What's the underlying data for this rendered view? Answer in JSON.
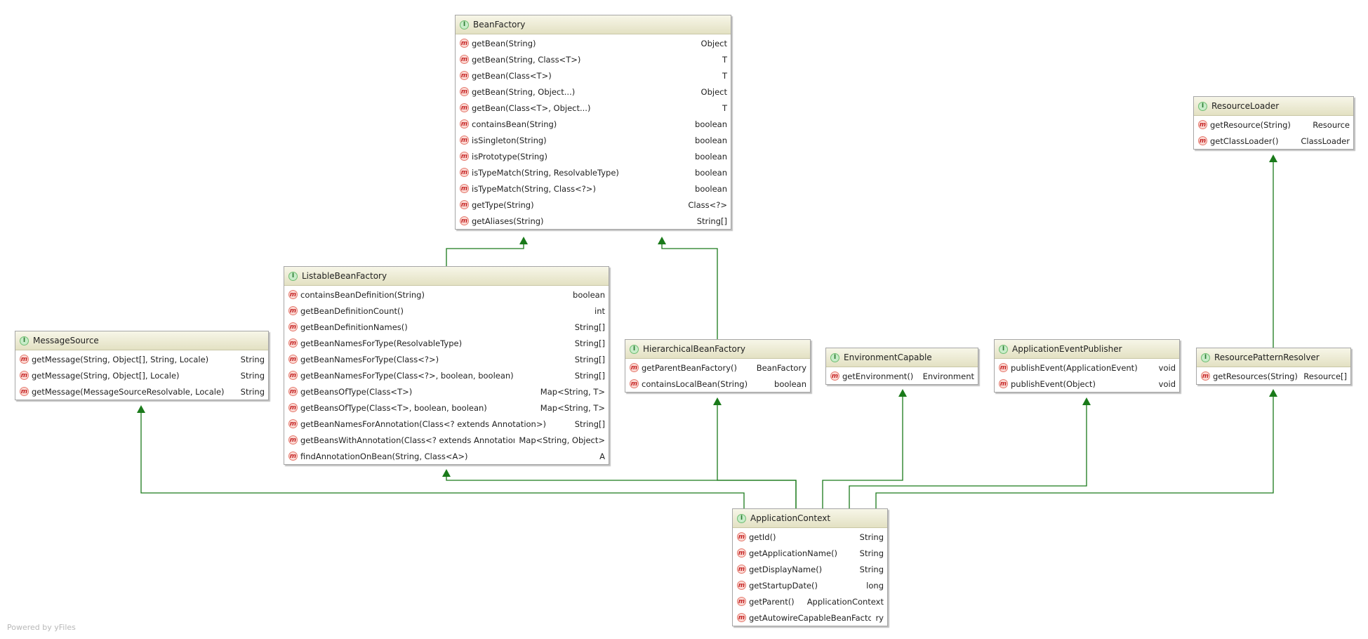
{
  "footer": "Powered by yFiles",
  "colors": {
    "edge": "#1a7a1a"
  },
  "nodes": {
    "beanfactory": {
      "title": "BeanFactory",
      "methods": [
        {
          "sig": "getBean(String)",
          "ret": "Object"
        },
        {
          "sig": "getBean(String, Class<T>)",
          "ret": "T"
        },
        {
          "sig": "getBean(Class<T>)",
          "ret": "T"
        },
        {
          "sig": "getBean(String, Object...)",
          "ret": "Object"
        },
        {
          "sig": "getBean(Class<T>, Object...)",
          "ret": "T"
        },
        {
          "sig": "containsBean(String)",
          "ret": "boolean"
        },
        {
          "sig": "isSingleton(String)",
          "ret": "boolean"
        },
        {
          "sig": "isPrototype(String)",
          "ret": "boolean"
        },
        {
          "sig": "isTypeMatch(String, ResolvableType)",
          "ret": "boolean"
        },
        {
          "sig": "isTypeMatch(String, Class<?>)",
          "ret": "boolean"
        },
        {
          "sig": "getType(String)",
          "ret": "Class<?>"
        },
        {
          "sig": "getAliases(String)",
          "ret": "String[]"
        }
      ]
    },
    "listable": {
      "title": "ListableBeanFactory",
      "methods": [
        {
          "sig": "containsBeanDefinition(String)",
          "ret": "boolean"
        },
        {
          "sig": "getBeanDefinitionCount()",
          "ret": "int"
        },
        {
          "sig": "getBeanDefinitionNames()",
          "ret": "String[]"
        },
        {
          "sig": "getBeanNamesForType(ResolvableType)",
          "ret": "String[]"
        },
        {
          "sig": "getBeanNamesForType(Class<?>)",
          "ret": "String[]"
        },
        {
          "sig": "getBeanNamesForType(Class<?>, boolean, boolean)",
          "ret": "String[]"
        },
        {
          "sig": "getBeansOfType(Class<T>)",
          "ret": "Map<String, T>"
        },
        {
          "sig": "getBeansOfType(Class<T>, boolean, boolean)",
          "ret": "Map<String, T>"
        },
        {
          "sig": "getBeanNamesForAnnotation(Class<? extends Annotation>)",
          "ret": "String[]"
        },
        {
          "sig": "getBeansWithAnnotation(Class<? extends Annotation>)",
          "ret": "Map<String, Object>"
        },
        {
          "sig": "findAnnotationOnBean(String, Class<A>)",
          "ret": "A"
        }
      ]
    },
    "messagesource": {
      "title": "MessageSource",
      "methods": [
        {
          "sig": "getMessage(String, Object[], String, Locale)",
          "ret": "String"
        },
        {
          "sig": "getMessage(String, Object[], Locale)",
          "ret": "String"
        },
        {
          "sig": "getMessage(MessageSourceResolvable, Locale)",
          "ret": "String"
        }
      ]
    },
    "hierarchical": {
      "title": "HierarchicalBeanFactory",
      "methods": [
        {
          "sig": "getParentBeanFactory()",
          "ret": "BeanFactory"
        },
        {
          "sig": "containsLocalBean(String)",
          "ret": "boolean"
        }
      ]
    },
    "envcapable": {
      "title": "EnvironmentCapable",
      "methods": [
        {
          "sig": "getEnvironment()",
          "ret": "Environment"
        }
      ]
    },
    "eventpublisher": {
      "title": "ApplicationEventPublisher",
      "methods": [
        {
          "sig": "publishEvent(ApplicationEvent)",
          "ret": "void"
        },
        {
          "sig": "publishEvent(Object)",
          "ret": "void"
        }
      ]
    },
    "resourceloader": {
      "title": "ResourceLoader",
      "methods": [
        {
          "sig": "getResource(String)",
          "ret": "Resource"
        },
        {
          "sig": "getClassLoader()",
          "ret": "ClassLoader"
        }
      ]
    },
    "patternresolver": {
      "title": "ResourcePatternResolver",
      "methods": [
        {
          "sig": "getResources(String)",
          "ret": "Resource[]"
        }
      ]
    },
    "appcontext": {
      "title": "ApplicationContext",
      "methods": [
        {
          "sig": "getId()",
          "ret": "String"
        },
        {
          "sig": "getApplicationName()",
          "ret": "String"
        },
        {
          "sig": "getDisplayName()",
          "ret": "String"
        },
        {
          "sig": "getStartupDate()",
          "ret": "long"
        },
        {
          "sig": "getParent()",
          "ret": "ApplicationContext"
        },
        {
          "sig": "getAutowireCapableBeanFactory()",
          "ret": "ry"
        }
      ]
    }
  },
  "edges": [
    {
      "from": "listable",
      "to": "beanfactory"
    },
    {
      "from": "hierarchical",
      "to": "beanfactory"
    },
    {
      "from": "patternresolver",
      "to": "resourceloader"
    },
    {
      "from": "appcontext",
      "to": "messagesource"
    },
    {
      "from": "appcontext",
      "to": "listable"
    },
    {
      "from": "appcontext",
      "to": "hierarchical"
    },
    {
      "from": "appcontext",
      "to": "envcapable"
    },
    {
      "from": "appcontext",
      "to": "eventpublisher"
    },
    {
      "from": "appcontext",
      "to": "patternresolver"
    }
  ]
}
